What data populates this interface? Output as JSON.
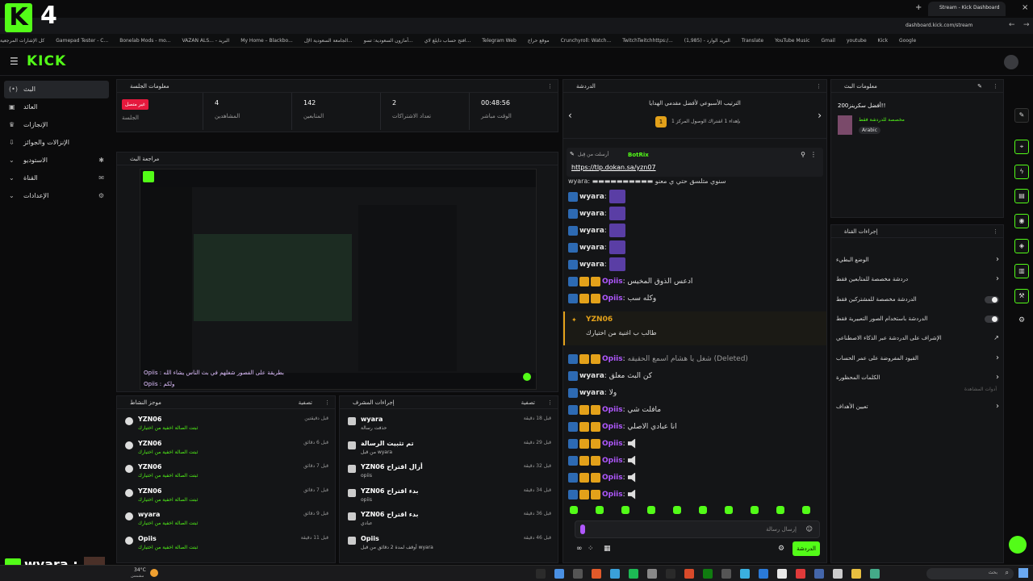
{
  "browser": {
    "tab_title": "Stream - Kick Dashboard",
    "url": "dashboard.kick.com/stream",
    "bookmarks": [
      "كل الإشارات المرجعية",
      "Gamepad Tester - C...",
      "Bonelab Mods - mo...",
      "VAZAN ALS... - البريد",
      "My Home – Blackbo...",
      "الجامعة السعودية الإل...",
      "أمازون السعودية: تسو...",
      "افتح حساب دايلغ لاي...",
      "Telegram Web",
      "موقع حراج",
      "Crunchyroll: Watch...",
      "TwitchTwitchhttps:/...",
      "البريد الوارد - (1,985)",
      "Translate",
      "YouTube Music",
      "Gmail",
      "youtube",
      "Kick",
      "Google"
    ]
  },
  "overlay": {
    "corner_logo": "K",
    "corner_num": "4",
    "bottom_user": "wyara :"
  },
  "header": {
    "logo": "KICK"
  },
  "nav": {
    "items": [
      {
        "label": "البث",
        "icon": "(•)"
      },
      {
        "label": "العائد",
        "icon": "▣"
      },
      {
        "label": "الإنجازات",
        "icon": "♛"
      },
      {
        "label": "الإنزالات والجوائز",
        "icon": "⇩"
      },
      {
        "label": "الاستوديو",
        "icon": "✱"
      },
      {
        "label": "القناة",
        "icon": "✉"
      },
      {
        "label": "الإعدادات",
        "icon": "⚙"
      }
    ]
  },
  "session": {
    "title": "معلومات الجلسة",
    "status_badge": "غير متصل",
    "status_label": "الجلسة",
    "stats": [
      {
        "value": "4",
        "label": "المشاهدين"
      },
      {
        "value": "142",
        "label": "المتابعين"
      },
      {
        "value": "2",
        "label": "تعداد الاشتراكات"
      },
      {
        "value": "00:48:56",
        "label": "الوقت مباشر"
      }
    ]
  },
  "preview": {
    "title": "مراجعة البث",
    "caption1": "Opiis : بطريقة على الفصور شغلهم في بث الناس يشاء الله",
    "caption2": "Opiis : ولكم"
  },
  "activity": {
    "title": "موجز النشاط",
    "filter": "تصفية",
    "rows": [
      {
        "name": "YZN06",
        "sub": "ثبتت الصالة اخفية من اختيارك",
        "time": "قبل دقيقتين"
      },
      {
        "name": "YZN06",
        "sub": "ثبتت الصالة اخفية من اختيارك",
        "time": "قبل 6 دقائق"
      },
      {
        "name": "YZN06",
        "sub": "ثبتت الصالة اخفية من اختيارك",
        "time": "قبل 7 دقائق"
      },
      {
        "name": "YZN06",
        "sub": "ثبتت الصالة اخفية من اختيارك",
        "time": "قبل 7 دقائق"
      },
      {
        "name": "wyara",
        "sub": "ثبتت الصالة اخفية من اختيارك",
        "time": "قبل 9 دقائق"
      },
      {
        "name": "Opiis",
        "sub": "ثبتت الصالة اخفية من اختيارك",
        "time": "قبل 11 دقيقة"
      }
    ]
  },
  "modactions": {
    "title": "إجراءات المشرف",
    "filter": "تصفية",
    "rows": [
      {
        "name": "wyara",
        "sub": "حذفت رسالة",
        "time": "قبل 18 دقيقة"
      },
      {
        "name": "تم تثبيت الرسالة",
        "sub": "من قبل wyara",
        "time": "قبل 29 دقيقة"
      },
      {
        "name": "YZN06 أزال اقتراح",
        "sub": "opiis",
        "time": "قبل 32 دقيقة"
      },
      {
        "name": "YZN06 بدء اقتراح",
        "sub": "opiis",
        "time": "قبل 34 دقيقة"
      },
      {
        "name": "YZN06 بدء اقتراح",
        "sub": "عبادي",
        "time": "قبل 36 دقيقة"
      },
      {
        "name": "Opiis",
        "sub": "أوقف لمدة 2 دقائق من قبل wyara",
        "time": "قبل 46 دقيقة"
      }
    ]
  },
  "chat": {
    "title": "الدردشة",
    "leaderboard_title": "الترتيب الأسبوعي لأفضل مقدمي الهدايا",
    "leaderboard_sub": "بإهداء 1 اشتراك الوصول المركز 1",
    "leaderboard_rank": "1",
    "pinned_by": "أرسلت من قِبل",
    "pinned_user": "BotRix",
    "pinned_link": "https://tlp.dokan.sa/yzn07",
    "top_partial": "wyara: ▬▬▬▬▬▬▬▬▬▬ سنوي متلسق حتي ي معنو",
    "messages": [
      {
        "user": "wyara",
        "type": "emote",
        "text": ""
      },
      {
        "user": "wyara",
        "type": "emote",
        "text": ""
      },
      {
        "user": "wyara",
        "type": "emote",
        "text": ""
      },
      {
        "user": "wyara",
        "type": "emote",
        "text": ""
      },
      {
        "user": "wyara",
        "type": "emote",
        "text": ""
      },
      {
        "user": "Opiis",
        "type": "text",
        "text": "ادعس الذوق المخيس"
      },
      {
        "user": "Opiis",
        "type": "text",
        "text": "وكله سب"
      }
    ],
    "highlight_user": "YZN06",
    "highlight_text": "طالب ب اغنية من اختيارك",
    "messages2": [
      {
        "user": "Opiis",
        "type": "deleted",
        "text": "شغل يا هشام اسمع الحقيقه (Deleted)"
      },
      {
        "user": "wyara",
        "type": "text",
        "text": "كن البث معلق"
      },
      {
        "user": "wyara",
        "type": "text",
        "text": "ولا"
      },
      {
        "user": "Opiis",
        "type": "text",
        "text": "مافلت شي"
      },
      {
        "user": "Opiis",
        "type": "text",
        "text": "انا عبادي الاصلي"
      },
      {
        "user": "Opiis",
        "type": "spk",
        "text": ""
      },
      {
        "user": "Opiis",
        "type": "spk",
        "text": ""
      },
      {
        "user": "Opiis",
        "type": "spk",
        "text": ""
      },
      {
        "user": "Opiis",
        "type": "spk",
        "text": ""
      }
    ],
    "input_placeholder": "إرسال رسالة",
    "send_label": "الدردشة"
  },
  "streaminfo": {
    "title": "معلومات البث",
    "stream_title": "أفضل سكرينز200!!",
    "category": "مخصصة للدردشة فقط",
    "language": "Arabic"
  },
  "channel_actions": {
    "title": "إجراءات القناة",
    "rows": [
      {
        "label": "الوضع البطيء",
        "kind": "chev"
      },
      {
        "label": "دردشة مخصصة للمتابعين فقط",
        "kind": "chev"
      },
      {
        "label": "الدردشة مخصصة للمشتركين فقط",
        "kind": "toggle"
      },
      {
        "label": "الدردشة باستخدام الصور التعبيرية فقط",
        "kind": "toggle"
      },
      {
        "label": "الإشراف على الدردشة عبر الذكاء الاصطناعي",
        "kind": "ext"
      },
      {
        "label": "القيود المفروضة على عمر الحساب",
        "kind": "chev"
      },
      {
        "label": "الكلمات المحظورة",
        "kind": "chev"
      }
    ],
    "section": "أدوات المشاهدة",
    "goals": "تعيين الأهداف"
  },
  "taskbar": {
    "weather": "34°C",
    "weather_sub": "مشمس",
    "lang": "بحث"
  },
  "colors": {
    "accent": "#53fc18",
    "badge_red": "#e5193d",
    "mod": "#2d6ab3"
  }
}
